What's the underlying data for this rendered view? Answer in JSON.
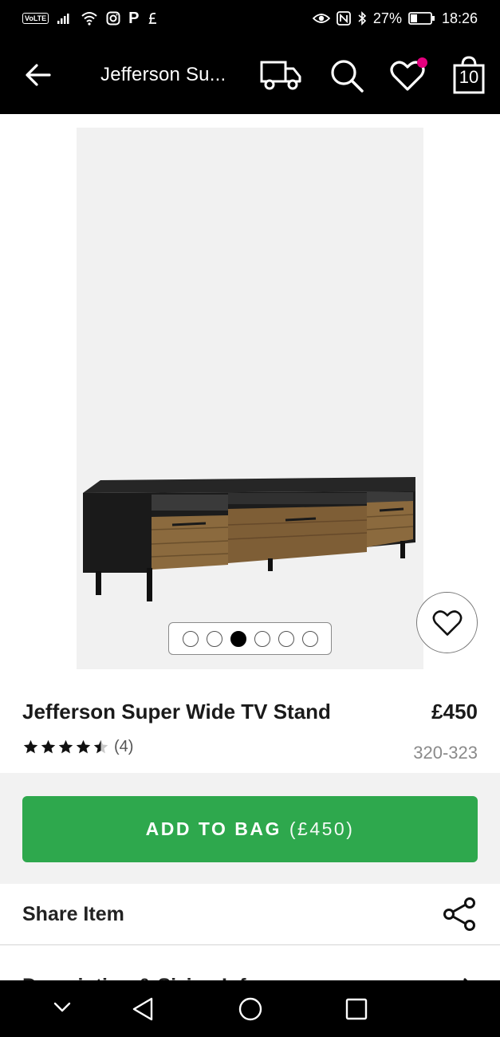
{
  "status_bar": {
    "volte": "VoLTE",
    "p_icon": "P",
    "battery": "27%",
    "time": "18:26",
    "icons": [
      "signal-icon",
      "wifi-icon",
      "instagram-icon",
      "p-icon",
      "money-icon",
      "eye-icon",
      "nfc-icon",
      "bluetooth-icon",
      "battery-icon"
    ]
  },
  "header": {
    "title": "Jefferson Su...",
    "bag_count": "10",
    "icons": [
      "back-arrow-icon",
      "delivery-truck-icon",
      "search-icon",
      "heart-icon",
      "shopping-bag-icon"
    ]
  },
  "product": {
    "name": "Jefferson Super Wide TV Stand",
    "price": "£450",
    "rating": 4.5,
    "review_count": "(4)",
    "code": "320-323",
    "image_count": 6,
    "active_image": 3
  },
  "actions": {
    "add_to_bag": "ADD TO BAG",
    "add_to_bag_price": "(£450)",
    "share": "Share Item",
    "description": "Description & Sizing Info"
  },
  "nav": {
    "icons": [
      "nav-down-icon",
      "nav-back-icon",
      "nav-home-icon",
      "nav-recents-icon"
    ]
  },
  "colors": {
    "primary_green": "#2ea84d",
    "wishlist_dot": "#e5007e",
    "header_bg": "#000000"
  }
}
